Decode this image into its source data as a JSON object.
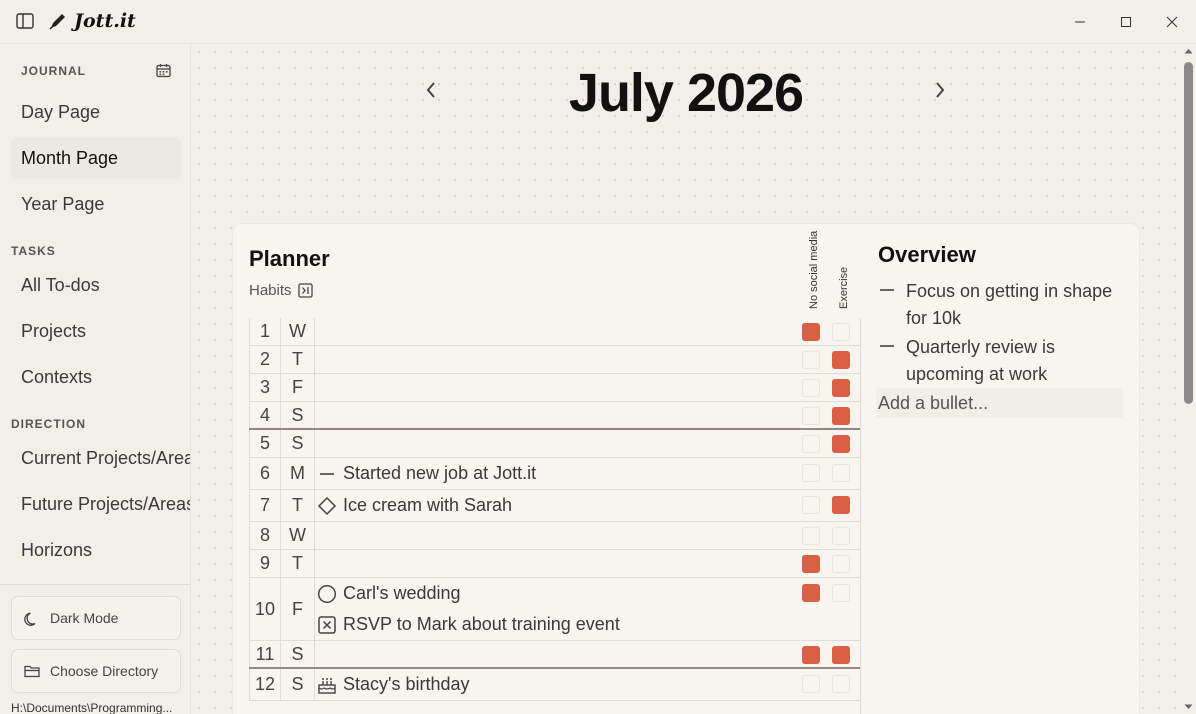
{
  "window": {
    "brand": "Jott.it"
  },
  "sidebar": {
    "journal_label": "JOURNAL",
    "tasks_label": "TASKS",
    "direction_label": "DIRECTION",
    "journal_items": [
      {
        "label": "Day Page"
      },
      {
        "label": "Month Page"
      },
      {
        "label": "Year Page"
      }
    ],
    "task_items": [
      {
        "label": "All To-dos"
      },
      {
        "label": "Projects"
      },
      {
        "label": "Contexts"
      }
    ],
    "direction_items": [
      {
        "label": "Current Projects/Areas"
      },
      {
        "label": "Future Projects/Areas"
      },
      {
        "label": "Horizons"
      }
    ],
    "active_item": "Month Page",
    "dark_mode_label": "Dark Mode",
    "choose_dir_label": "Choose Directory",
    "path": "H:\\Documents\\Programming..."
  },
  "main": {
    "month_title": "July 2026",
    "planner_title": "Planner",
    "habits_label": "Habits",
    "habit_names": [
      "No social media",
      "Exercise"
    ],
    "overview_title": "Overview",
    "overview_items": [
      {
        "text": "Focus on getting in shape for 10k"
      },
      {
        "text": "Quarterly review is upcoming at work"
      }
    ],
    "add_bullet_placeholder": "Add a bullet...",
    "accent_color": "#d95f45",
    "days": [
      {
        "day": "1",
        "dow": "W",
        "entries": [],
        "habits": [
          true,
          false
        ]
      },
      {
        "day": "2",
        "dow": "T",
        "entries": [],
        "habits": [
          false,
          true
        ]
      },
      {
        "day": "3",
        "dow": "F",
        "entries": [],
        "habits": [
          false,
          true
        ]
      },
      {
        "day": "4",
        "dow": "S",
        "entries": [],
        "habits": [
          false,
          true
        ]
      },
      {
        "day": "5",
        "dow": "S",
        "entries": [],
        "habits": [
          false,
          true
        ]
      },
      {
        "day": "6",
        "dow": "M",
        "entries": [
          {
            "icon": "dash-icon",
            "text": "Started new job at Jott.it"
          }
        ],
        "habits": [
          false,
          false
        ]
      },
      {
        "day": "7",
        "dow": "T",
        "entries": [
          {
            "icon": "diamond-icon",
            "text": "Ice cream with Sarah"
          }
        ],
        "habits": [
          false,
          true
        ]
      },
      {
        "day": "8",
        "dow": "W",
        "entries": [],
        "habits": [
          false,
          false
        ]
      },
      {
        "day": "9",
        "dow": "T",
        "entries": [],
        "habits": [
          true,
          false
        ]
      },
      {
        "day": "10",
        "dow": "F",
        "entries": [
          {
            "icon": "circle-icon",
            "text": "Carl's wedding"
          },
          {
            "icon": "cancelled-task-icon",
            "text": "RSVP to Mark about training event"
          }
        ],
        "habits": [
          true,
          false
        ]
      },
      {
        "day": "11",
        "dow": "S",
        "entries": [],
        "habits": [
          true,
          true
        ]
      },
      {
        "day": "12",
        "dow": "S",
        "entries": [
          {
            "icon": "cake-icon",
            "text": "Stacy's birthday"
          }
        ],
        "habits": [
          false,
          false
        ]
      }
    ]
  }
}
